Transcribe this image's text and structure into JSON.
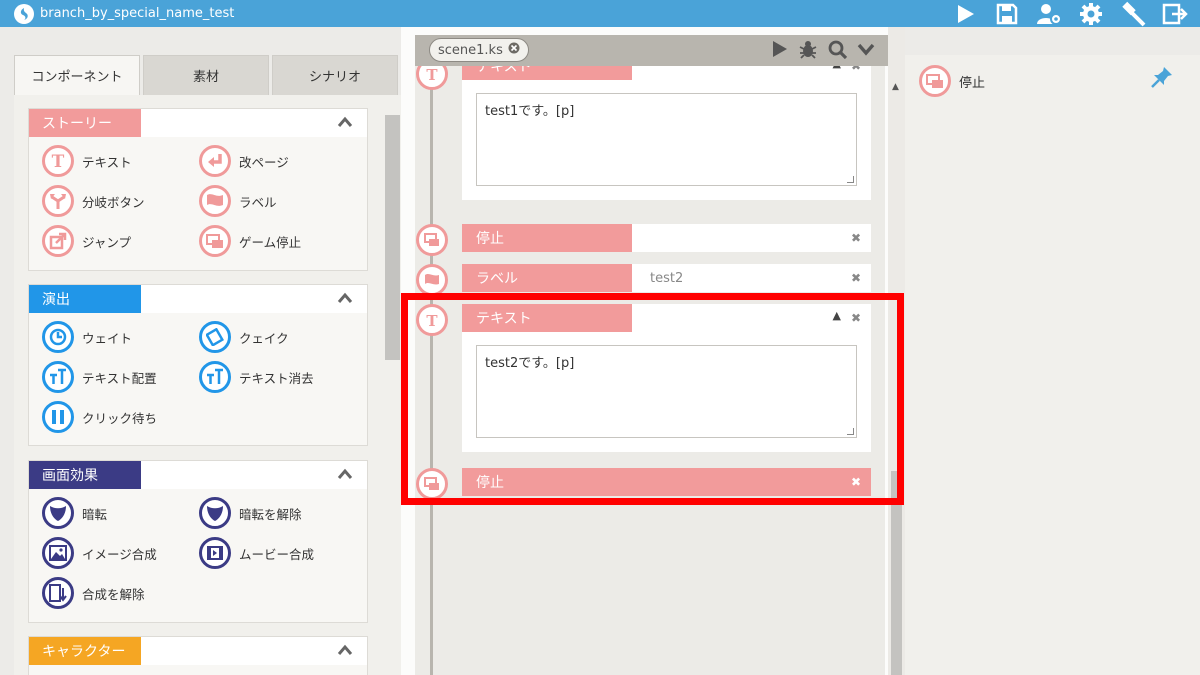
{
  "app": {
    "title": "branch_by_special_name_test",
    "toolbar_icons": [
      "play-icon",
      "save-icon",
      "user-settings-icon",
      "gear-icon",
      "hammer-icon",
      "exit-icon"
    ]
  },
  "palette": {
    "tabs": [
      {
        "label": "コンポーネント",
        "active": true
      },
      {
        "label": "素材",
        "active": false
      },
      {
        "label": "シナリオ",
        "active": false
      }
    ],
    "groups": [
      {
        "label": "ストーリー",
        "color": "#f29b9b",
        "items": [
          {
            "label": "テキスト",
            "icon": "text-t-icon"
          },
          {
            "label": "改ページ",
            "icon": "page-break-icon"
          },
          {
            "label": "分岐ボタン",
            "icon": "branch-button-icon"
          },
          {
            "label": "ラベル",
            "icon": "flag-icon"
          },
          {
            "label": "ジャンプ",
            "icon": "jump-icon"
          },
          {
            "label": "ゲーム停止",
            "icon": "game-stop-icon"
          }
        ]
      },
      {
        "label": "演出",
        "color": "#2196e8",
        "items": [
          {
            "label": "ウェイト",
            "icon": "clock-icon"
          },
          {
            "label": "クェイク",
            "icon": "quake-icon"
          },
          {
            "label": "テキスト配置",
            "icon": "text-position-icon"
          },
          {
            "label": "テキスト消去",
            "icon": "text-clear-icon"
          },
          {
            "label": "クリック待ち",
            "icon": "pause-icon"
          }
        ]
      },
      {
        "label": "画面効果",
        "color": "#3b3b85",
        "items": [
          {
            "label": "暗転",
            "icon": "blackout-icon"
          },
          {
            "label": "暗転を解除",
            "icon": "blackout-release-icon"
          },
          {
            "label": "イメージ合成",
            "icon": "image-compose-icon"
          },
          {
            "label": "ムービー合成",
            "icon": "movie-compose-icon"
          },
          {
            "label": "合成を解除",
            "icon": "compose-release-icon"
          }
        ]
      },
      {
        "label": "キャラクター",
        "color": "#f5a623",
        "items": []
      }
    ]
  },
  "scene": {
    "tab_label": "scene1.ks",
    "commands": [
      {
        "type": "テキスト",
        "text": "test1です。[p]"
      },
      {
        "type": "停止"
      },
      {
        "type": "ラベル",
        "param": "test2"
      },
      {
        "type": "テキスト",
        "text": "test2です。[p]"
      },
      {
        "type": "停止"
      }
    ],
    "partial_header": "テキスト"
  },
  "right_panel": {
    "item_label": "停止"
  }
}
